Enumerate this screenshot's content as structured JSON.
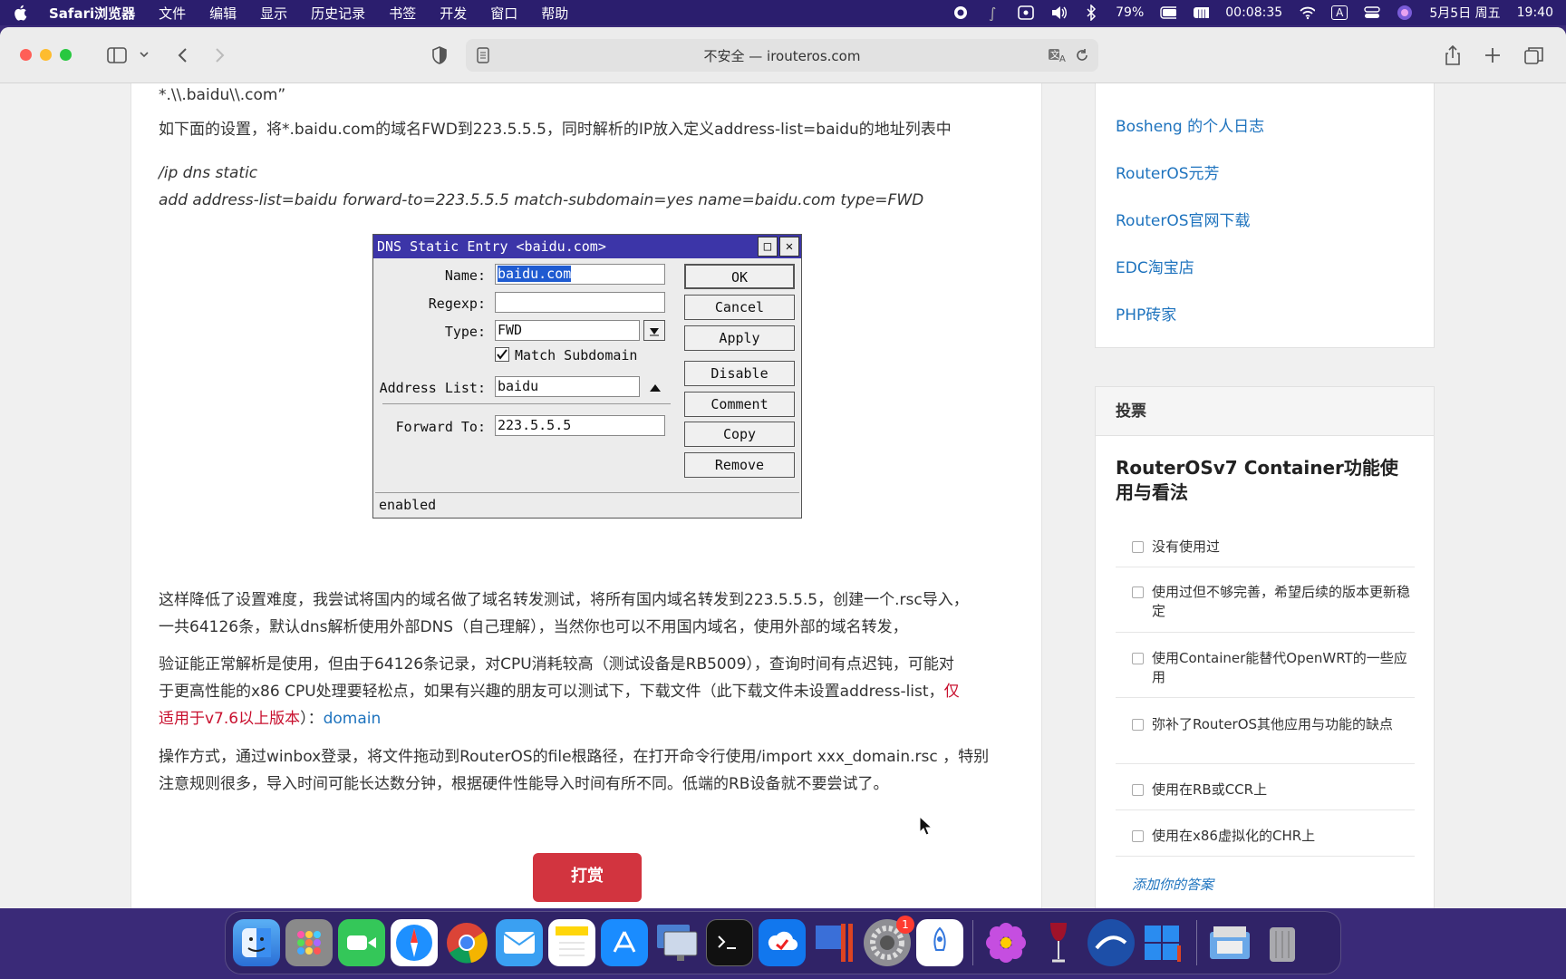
{
  "menubar": {
    "app_name": "Safari浏览器",
    "items": [
      "文件",
      "编辑",
      "显示",
      "历史记录",
      "书签",
      "开发",
      "窗口",
      "帮助"
    ],
    "battery_pct": "79%",
    "timer": "00:08:35",
    "input_method": "A",
    "date": "5月5日 周五",
    "time": "19:40"
  },
  "browser": {
    "address_text": "不安全 — irouteros.com"
  },
  "article": {
    "line_top": "*.\\\\.baidu\\\\.com”",
    "para1": "如下面的设置，将*.baidu.com的域名FWD到223.5.5.5，同时解析的IP放入定义address-list=baidu的地址列表中",
    "code1": "/ip dns static",
    "code2": "add address-list=baidu forward-to=223.5.5.5 match-subdomain=yes name=baidu.com type=FWD",
    "para2a": "这样降低了设置难度，我尝试将国内的域名做了域名转发测试，将所有国内域名转发到223.5.5.5，创建一个.rsc导入，",
    "para2b": "一共64126条，默认dns解析使用外部DNS（自己理解），当然你也可以不用国内域名，使用外部的域名转发，",
    "para3a": "验证能正常解析是使用，但由于64126条记录，对CPU消耗较高（测试设备是RB5009），查询时间有点迟钝，可能对",
    "para3b": "于更高性能的x86 CPU处理要轻松点，如果有兴趣的朋友可以测试下，下载文件（此下载文件未设置address-list，",
    "para3_red1": "仅",
    "para3_red2": "适用于v7.6以上版本",
    "para3_tail": "）：",
    "para3_link": "domain",
    "para4a": "操作方式，通过winbox登录，将文件拖动到RouterOS的file根路径，在打开命令行使用/import xxx_domain.rsc ，特别",
    "para4b": "注意规则很多，导入时间可能长达数分钟，根据硬件性能导入时间有所不同。低端的RB设备就不要尝试了。",
    "reward_label": "打赏"
  },
  "dialog": {
    "title": "DNS Static Entry <baidu.com>",
    "labels": {
      "name": "Name:",
      "regexp": "Regexp:",
      "type": "Type:",
      "address_list": "Address List:",
      "forward_to": "Forward To:"
    },
    "values": {
      "name": "baidu.com",
      "regexp": "",
      "type": "FWD",
      "match_subdomain": "Match Subdomain",
      "address_list": "baidu",
      "forward_to": "223.5.5.5"
    },
    "buttons": [
      "OK",
      "Cancel",
      "Apply",
      "Disable",
      "Comment",
      "Copy",
      "Remove"
    ],
    "status": "enabled"
  },
  "sidebar": {
    "links": [
      "RouterOS元芳",
      "RouterOS官网下载",
      "EDC淘宝店",
      "PHP砖家"
    ],
    "links_top": [
      "Bosheng 的个人日志"
    ],
    "vote_header": "投票",
    "vote_question": "RouterOSv7 Container功能使用与看法",
    "options": [
      "没有使用过",
      "使用过但不够完善，希望后续的版本更新稳定",
      "使用Container能替代OpenWRT的一些应用",
      "弥补了RouterOS其他应用与功能的缺点",
      "使用在RB或CCR上",
      "使用在x86虚拟化的CHR上"
    ],
    "add_answer": "添加你的答案"
  },
  "dock": {
    "apps": [
      "finder-icon",
      "launchpad-icon",
      "facetime-icon",
      "safari-icon",
      "chrome-icon",
      "mail-icon",
      "notes-icon",
      "appstore-icon",
      "screen-icon",
      "terminal-icon",
      "transfer-icon",
      "parallels-icon",
      "settings-icon",
      "rocket-icon",
      "flower-icon",
      "wine-icon",
      "app-icon",
      "windows-icon",
      "folder-icon",
      "trash-icon"
    ],
    "settings_badge": "1"
  },
  "colors": {
    "link": "#1e73be",
    "accent_red": "#c8102e",
    "reward": "#d2343f",
    "dialog_title": "#3c35a8"
  }
}
